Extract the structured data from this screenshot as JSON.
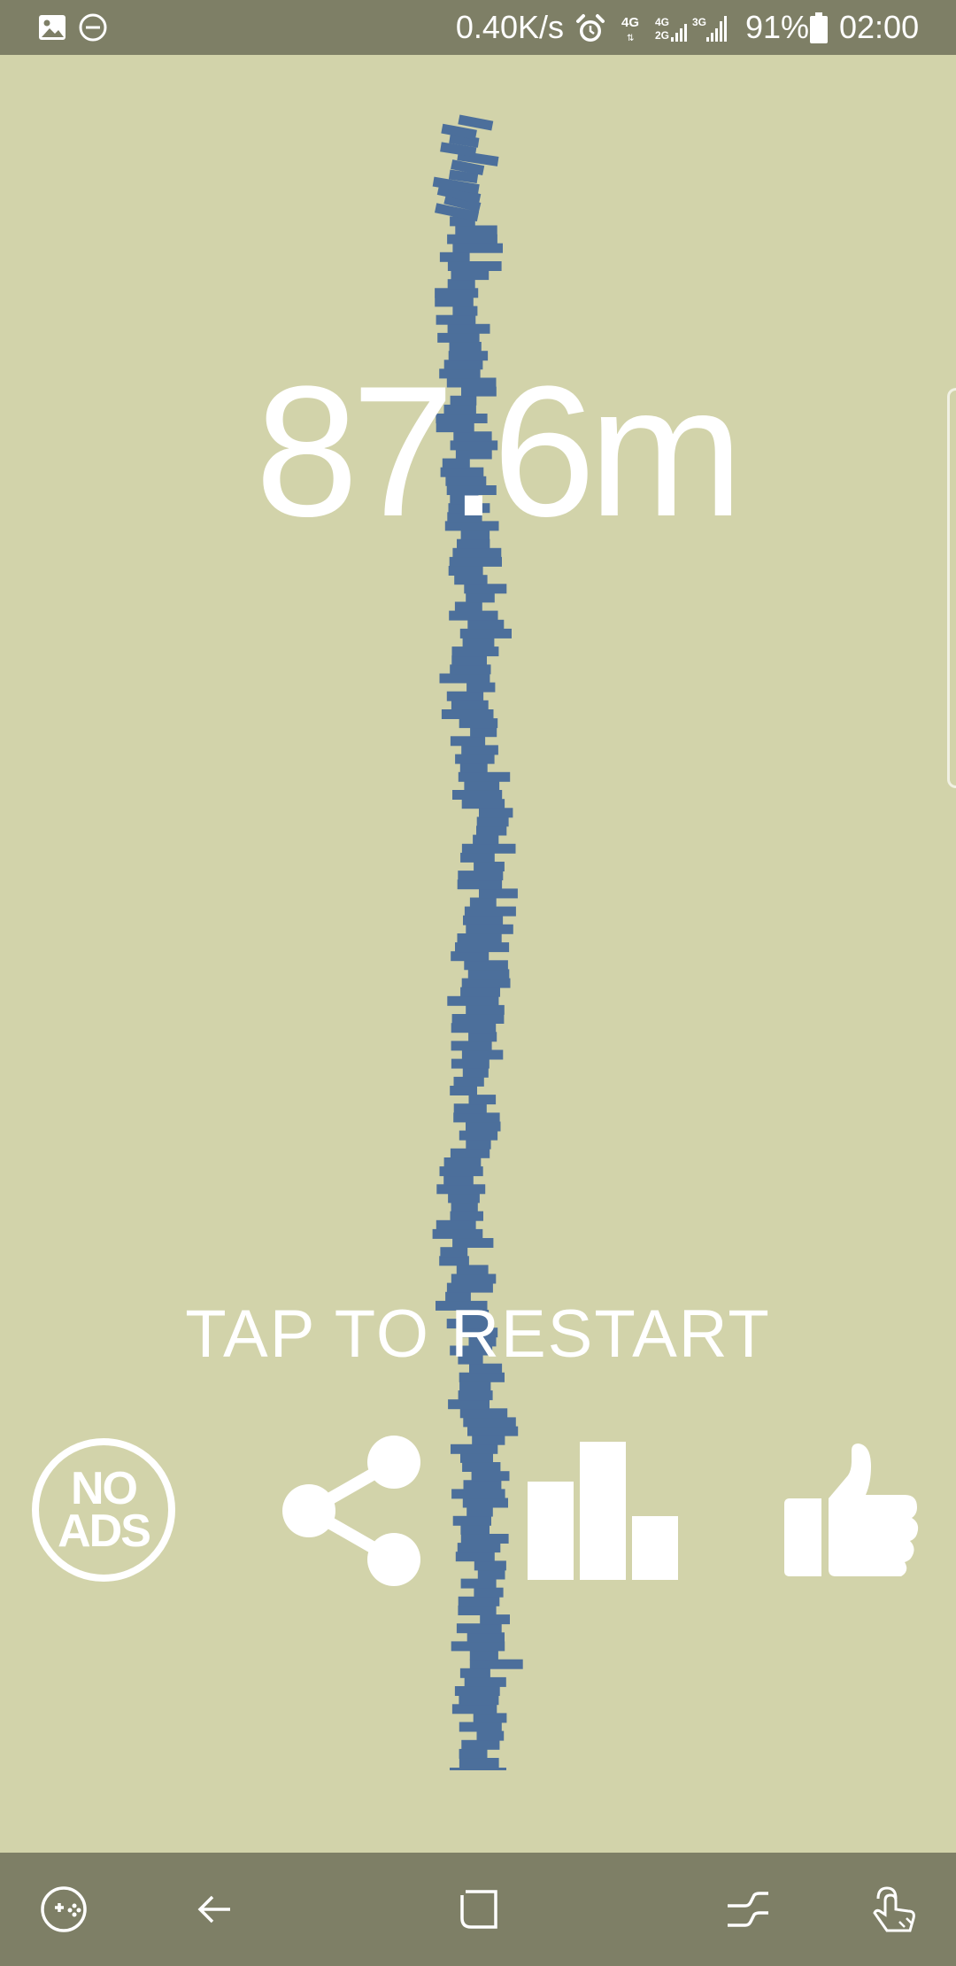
{
  "status_bar": {
    "net_speed": "0.40K/s",
    "battery_percent": "91%",
    "time": "02:00",
    "icons": [
      "gallery-icon",
      "do-not-disturb-icon",
      "alarm-icon",
      "signal-icon",
      "battery-icon"
    ],
    "network_labels": [
      "4G",
      "4G",
      "2G",
      "3G"
    ]
  },
  "game": {
    "distance": "87.6m",
    "restart_prompt": "TAP TO RESTART",
    "background_color": "#d2d3aa",
    "block_color": "#4c6f9b"
  },
  "actions": {
    "no_ads_line1": "NO",
    "no_ads_line2": "ADS",
    "icons": [
      "no-ads-icon",
      "share-icon",
      "leaderboard-icon",
      "thumbs-up-icon"
    ]
  },
  "nav_bar": {
    "icons": [
      "game-launcher-icon",
      "back-icon",
      "home-icon",
      "recents-icon",
      "assistant-gesture-icon"
    ]
  }
}
